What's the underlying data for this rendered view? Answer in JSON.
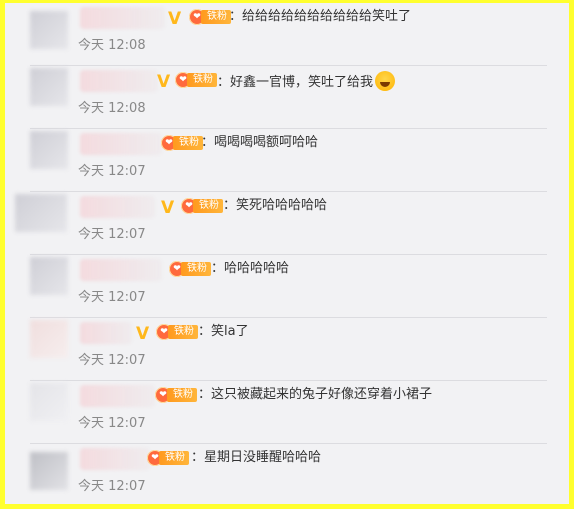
{
  "fan_badge_label": "铁粉",
  "comments": [
    {
      "text": "：给给给给给给给给给给笑吐了",
      "time": "今天 12:08",
      "vip": true,
      "emoji": false
    },
    {
      "text": "：好鑫一官博，笑吐了给我",
      "time": "今天 12:08",
      "vip": true,
      "emoji": true,
      "emoji_name": "laugh-cry-emoji"
    },
    {
      "text": "：喝喝喝喝额呵哈哈",
      "time": "今天 12:07",
      "vip": false,
      "emoji": false
    },
    {
      "text": "：笑死哈哈哈哈哈",
      "time": "今天 12:07",
      "vip": true,
      "emoji": false
    },
    {
      "text": "：哈哈哈哈哈",
      "time": "今天 12:07",
      "vip": false,
      "emoji": false
    },
    {
      "text": "：笑la了",
      "time": "今天 12:07",
      "vip": true,
      "emoji": false
    },
    {
      "text": "：这只被藏起来的兔子好像还穿着小裙子",
      "time": "今天 12:07",
      "vip": false,
      "emoji": false
    },
    {
      "text": "：星期日没睡醒哈哈哈",
      "time": "今天 12:07",
      "vip": false,
      "emoji": false
    }
  ],
  "colors": {
    "frame_border": "#ffff2e",
    "background": "#f2f2f4",
    "vip": "#ffb81c",
    "badge": "#ff9a1f",
    "time": "#888888"
  }
}
